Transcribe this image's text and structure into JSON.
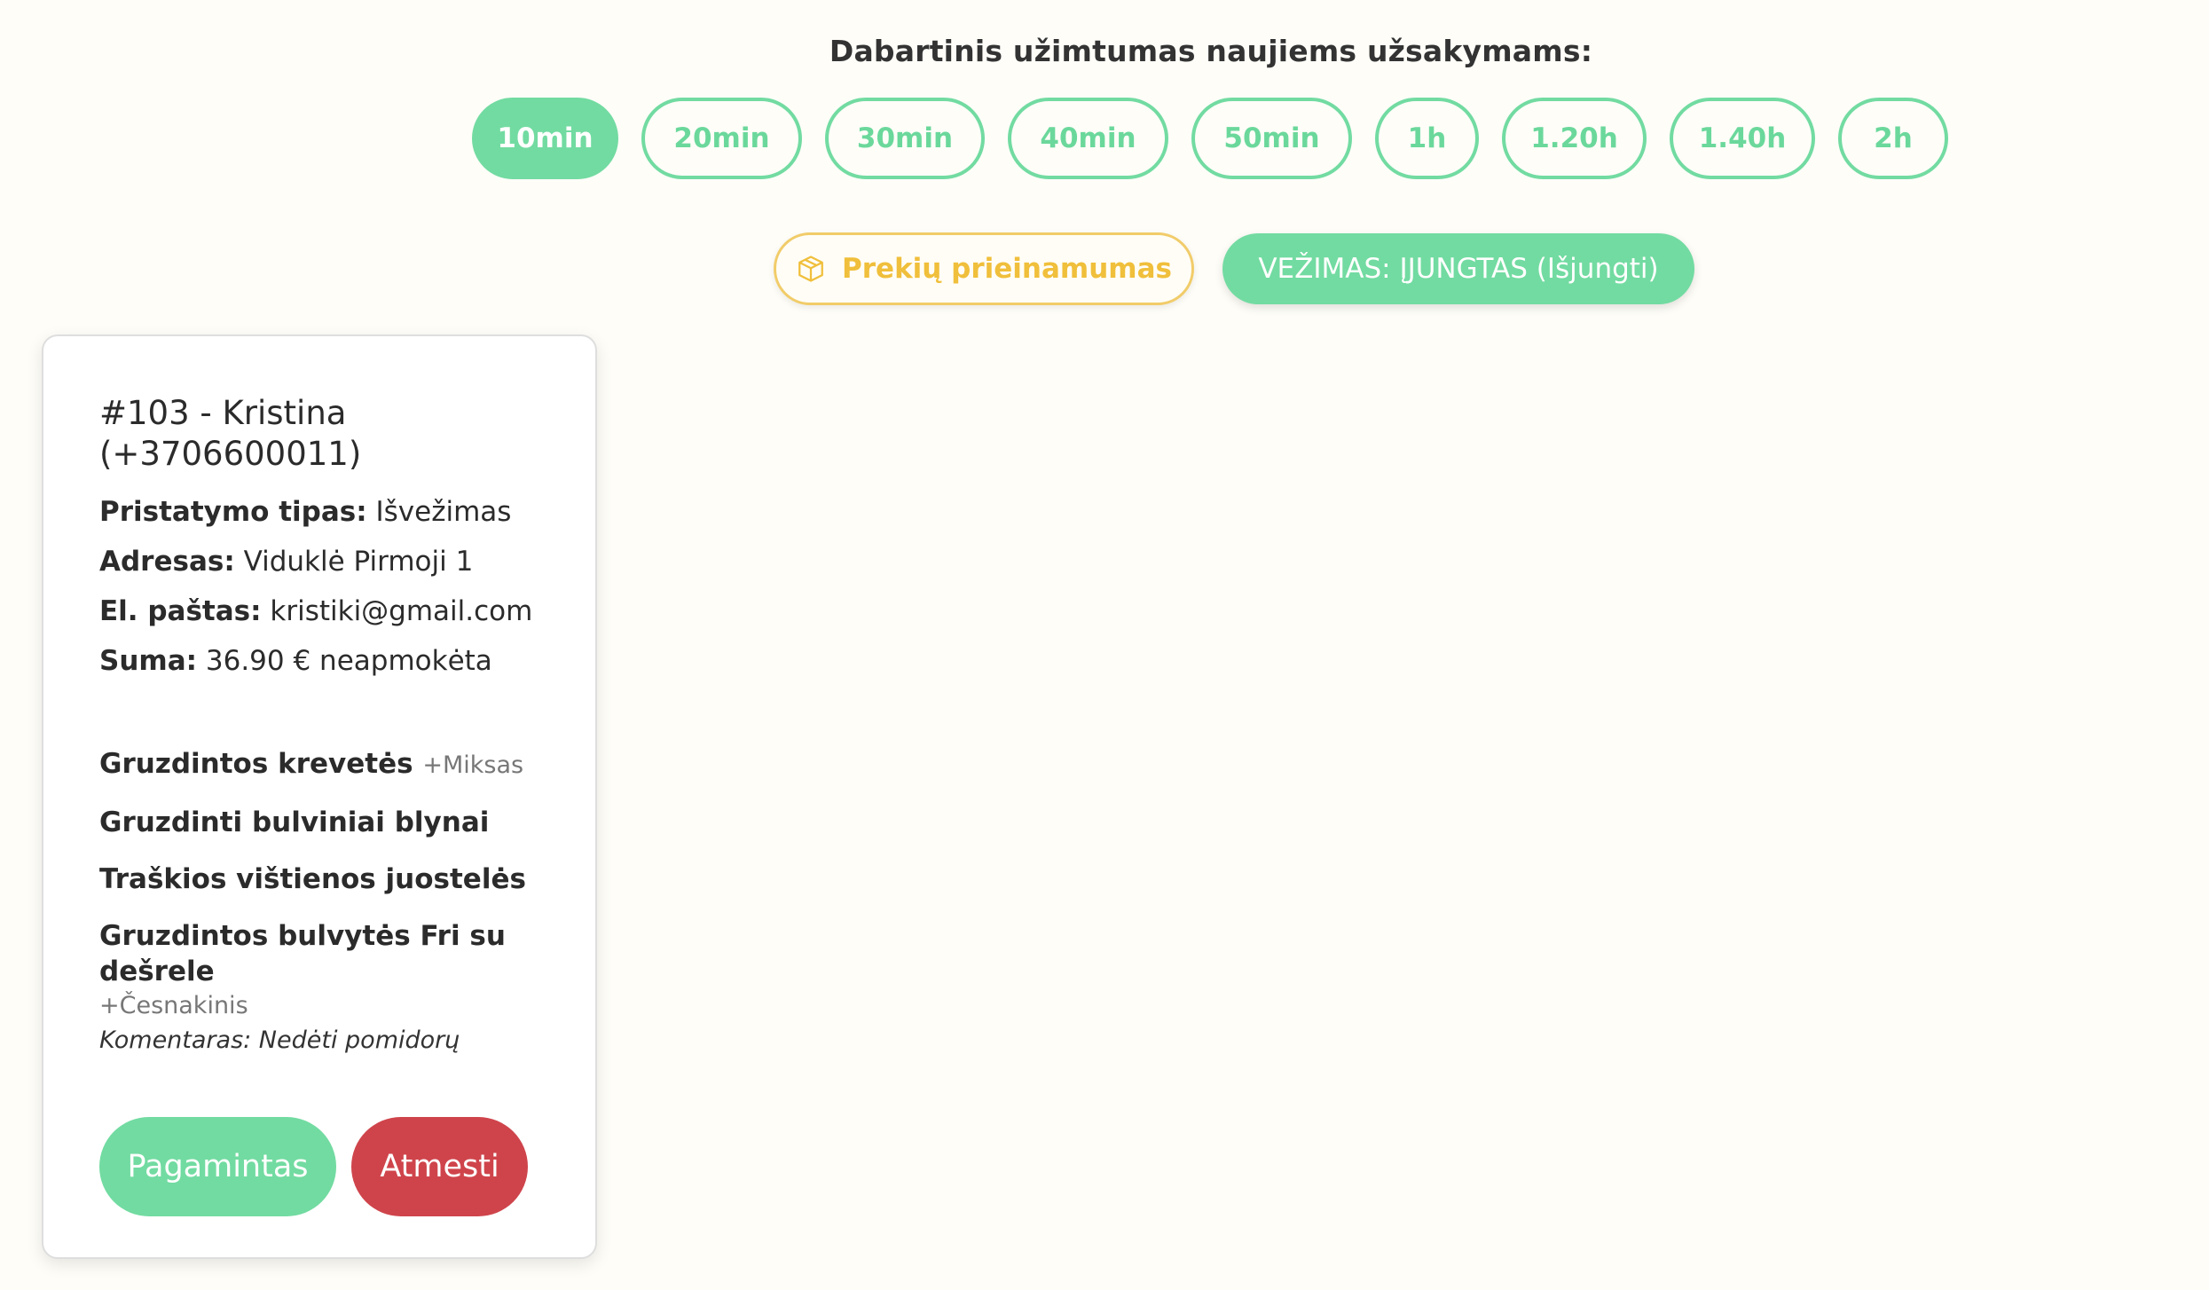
{
  "header": {
    "title": "Dabartinis užimtumas naujiems užsakymams:"
  },
  "busy_times": [
    {
      "label": "10min",
      "active": true
    },
    {
      "label": "20min",
      "active": false
    },
    {
      "label": "30min",
      "active": false
    },
    {
      "label": "40min",
      "active": false
    },
    {
      "label": "50min",
      "active": false
    },
    {
      "label": "1h",
      "active": false
    },
    {
      "label": "1.20h",
      "active": false
    },
    {
      "label": "1.40h",
      "active": false
    },
    {
      "label": "2h",
      "active": false
    }
  ],
  "actions": {
    "stock_label": "Prekių prieinamumas",
    "stock_icon": "box-icon",
    "delivery_label": "VEŽIMAS: ĮJUNGTAS (Išjungti)"
  },
  "order": {
    "title": "#103 - Kristina (+3706600011)",
    "delivery_type_label": "Pristatymo tipas:",
    "delivery_type": "Išvežimas",
    "address_label": "Adresas:",
    "address": "Viduklė Pirmoji 1",
    "email_label": "El. paštas:",
    "email": "kristiki@gmail.com",
    "sum_label": "Suma:",
    "sum": "36.90 € neapmokėta",
    "items": [
      {
        "name": "Gruzdintos krevetės",
        "addon": "+Miksas"
      },
      {
        "name": "Gruzdinti bulviniai blynai",
        "addon": ""
      },
      {
        "name": "Traškios vištienos juostelės",
        "addon": ""
      },
      {
        "name": "Gruzdintos bulvytės Fri su dešrele",
        "addon": "+Česnakinis",
        "comment": "Komentaras: Nedėti pomidorų"
      }
    ],
    "done_label": "Pagamintas",
    "reject_label": "Atmesti"
  },
  "colors": {
    "accent_green": "#72dba1",
    "accent_yellow": "#f0bf3b",
    "danger_red": "#cf444b",
    "background": "#fefdf8"
  }
}
